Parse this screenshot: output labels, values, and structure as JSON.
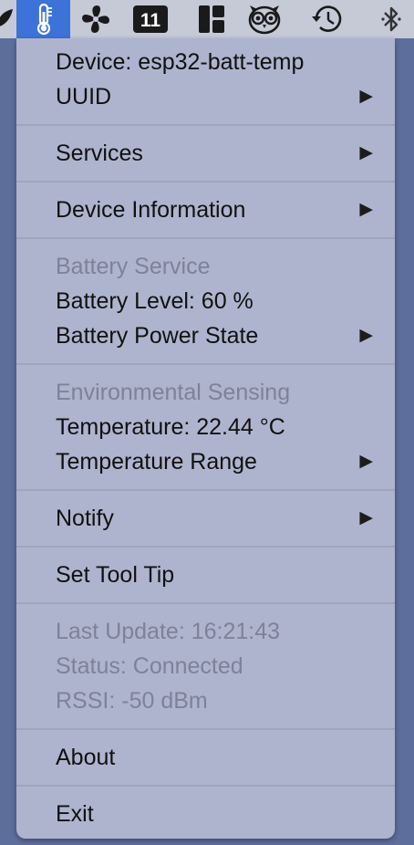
{
  "menubar": {
    "icons": [
      {
        "name": "leaf-icon"
      },
      {
        "name": "thermometer-icon"
      },
      {
        "name": "fan-icon"
      },
      {
        "name": "calendar-icon",
        "label": "11"
      },
      {
        "name": "layout-icon"
      },
      {
        "name": "owl-icon"
      },
      {
        "name": "time-machine-icon"
      },
      {
        "name": "bluetooth-icon"
      }
    ],
    "active_color": "#3d73d8"
  },
  "menu": {
    "device": "Device: esp32-batt-temp",
    "uuid": "UUID",
    "services": "Services",
    "device_information": "Device Information",
    "battery_service_header": "Battery Service",
    "battery_level": "Battery Level: 60 %",
    "battery_power_state": "Battery Power State",
    "env_header": "Environmental Sensing",
    "temperature": "Temperature: 22.44 °C",
    "temperature_range": "Temperature Range",
    "notify": "Notify",
    "set_tool_tip": "Set Tool Tip",
    "last_update": "Last Update: 16:21:43",
    "status": "Status: Connected",
    "rssi": "RSSI: -50 dBm",
    "about": "About",
    "exit": "Exit",
    "submenu_arrow": "▶"
  }
}
